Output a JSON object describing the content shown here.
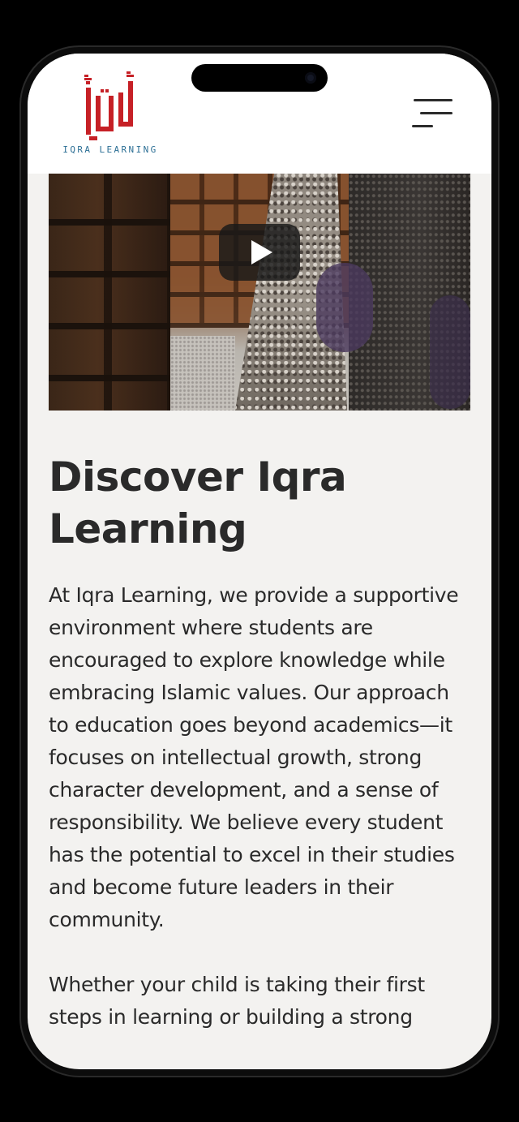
{
  "header": {
    "logo": {
      "glyph_text": "إقرأ",
      "wordmark": "IQRA LEARNING"
    },
    "menu_icon": "hamburger-menu-icon"
  },
  "video": {
    "play_icon": "play-icon"
  },
  "content": {
    "title": "Discover Iqra Learning",
    "paragraph_1": "At Iqra Learning, we provide a supportive environment where students are encouraged to explore knowledge while embracing Islamic values. Our approach to education goes beyond academics—it focuses on intellectual growth, strong character development, and a sense of responsibility. We believe every student has the potential to excel in their studies and become future leaders in their community.",
    "paragraph_2": "Whether your child is taking their first steps in learning or building a strong"
  },
  "colors": {
    "logo_red": "#c62026",
    "logo_blue": "#2c6f95",
    "text": "#2a2a2a",
    "page_background": "#f3f2f0",
    "header_background": "#ffffff"
  }
}
